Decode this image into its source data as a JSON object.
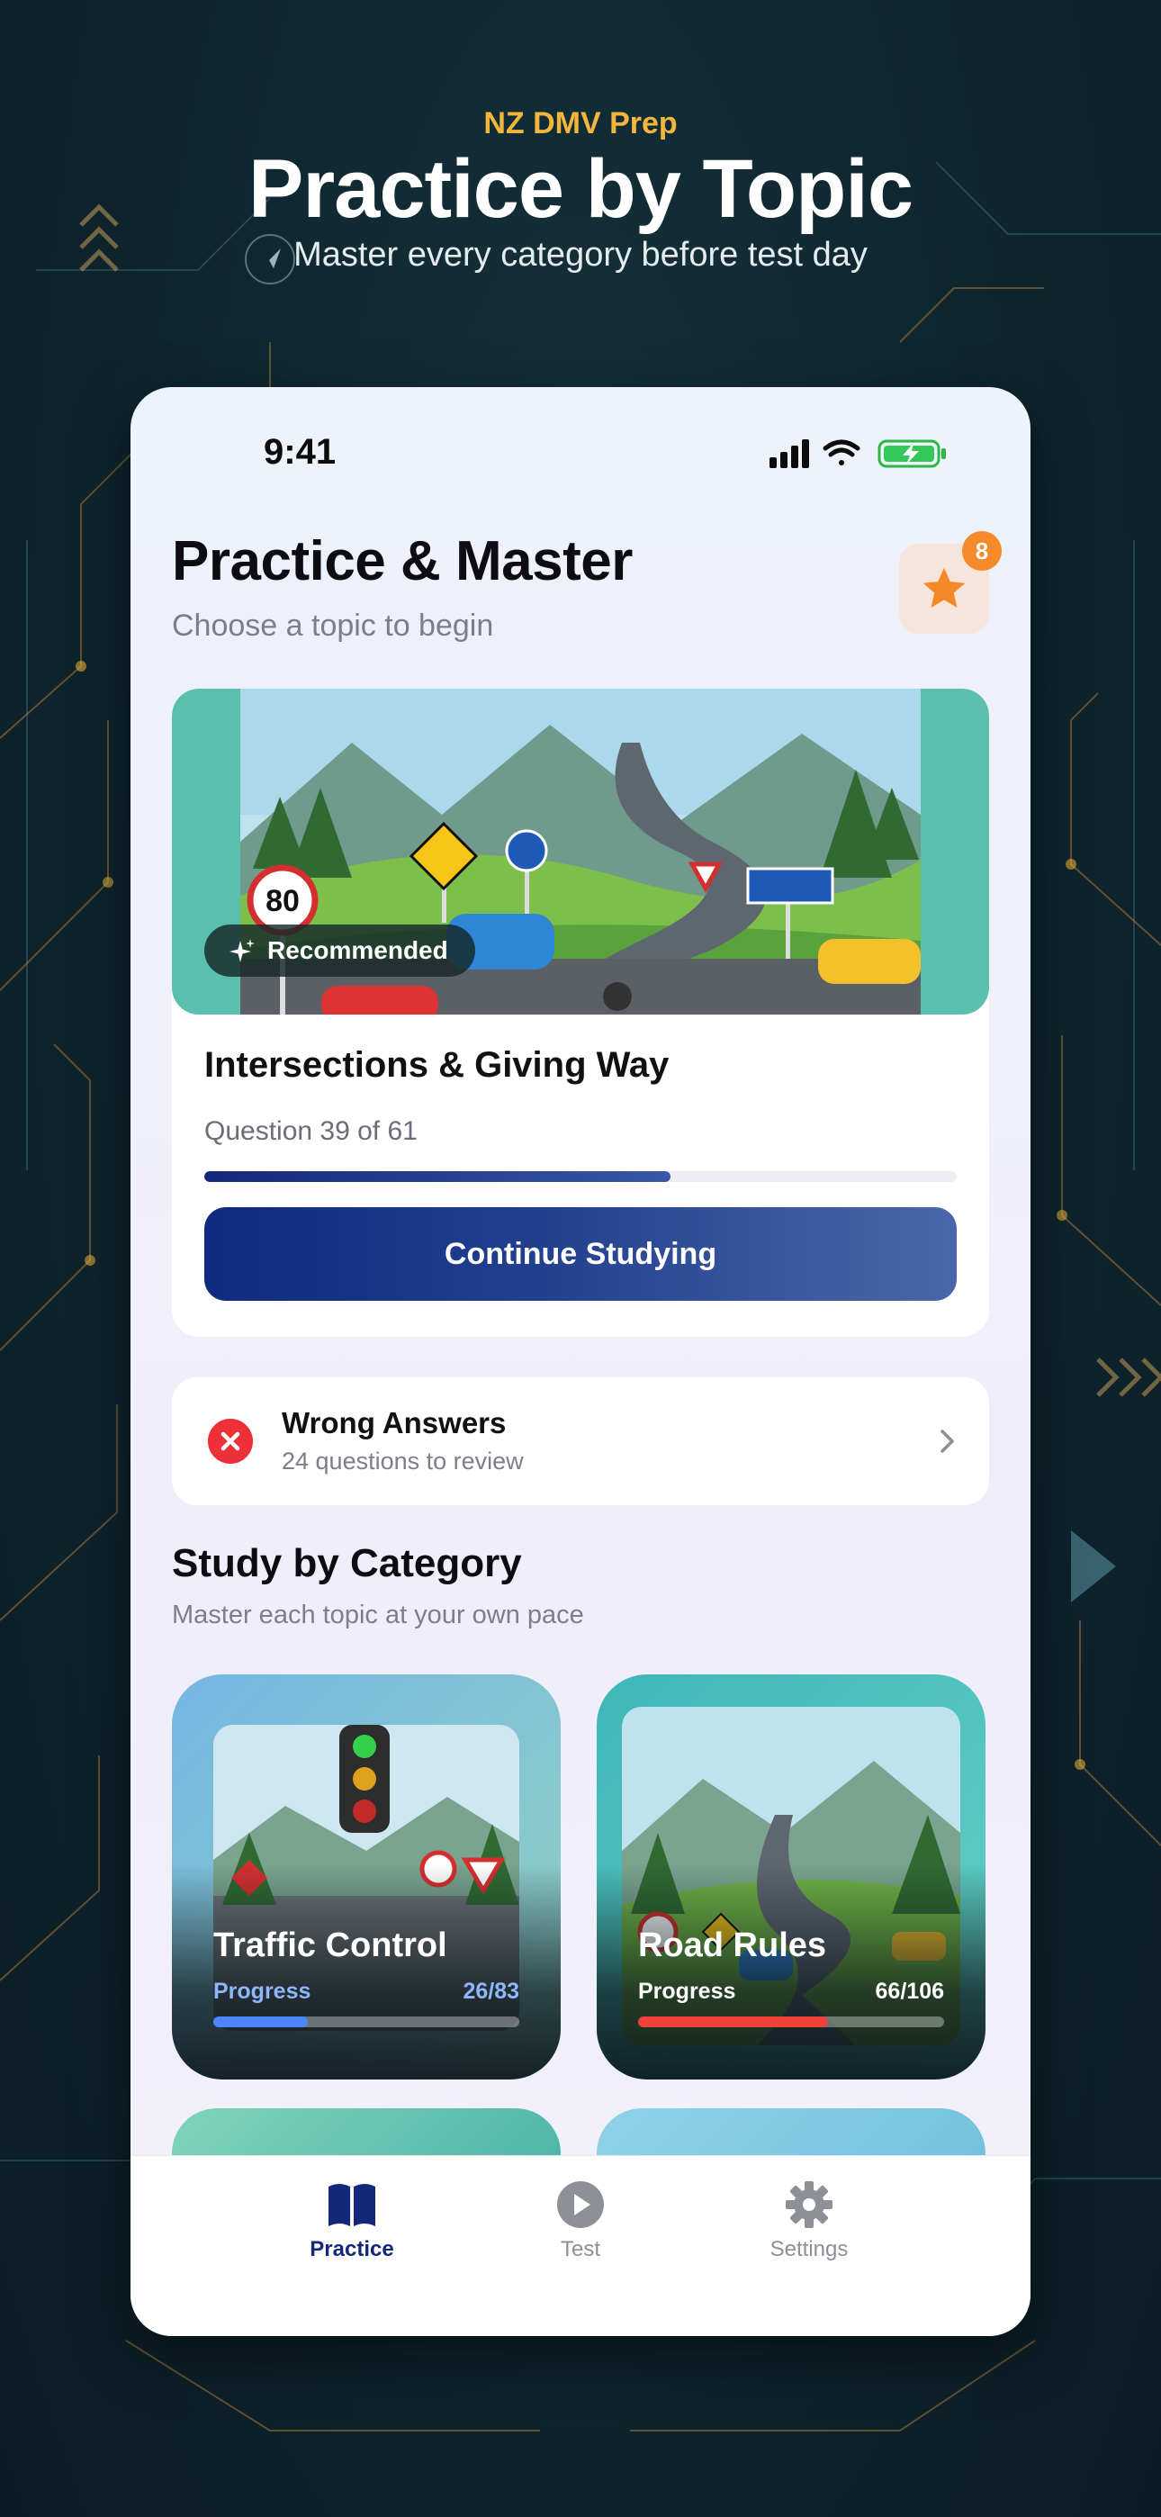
{
  "promo": {
    "eyebrow": "NZ DMV Prep",
    "title": "Practice by Topic",
    "subtitle": "Master every category before test day"
  },
  "status_bar": {
    "time": "9:41",
    "icons": [
      "signal-icon",
      "wifi-icon",
      "battery-charging-icon"
    ]
  },
  "header": {
    "title": "Practice & Master",
    "subtitle": "Choose a topic to begin",
    "favorites_badge": "8"
  },
  "featured": {
    "badge": "Recommended",
    "title": "Intersections & Giving Way",
    "progress_text": "Question 39 of 61",
    "progress_fraction": 0.62,
    "button": "Continue Studying"
  },
  "wrong_answers": {
    "title": "Wrong Answers",
    "subtitle": "24 questions to review"
  },
  "section": {
    "title": "Study by Category",
    "subtitle": "Master each topic at your own pace"
  },
  "categories": [
    {
      "title": "Traffic Control",
      "progress_label": "Progress",
      "count": "26/83",
      "fraction": 0.31,
      "color": "#4c86ff"
    },
    {
      "title": "Road Rules",
      "progress_label": "Progress",
      "count": "66/106",
      "fraction": 0.62,
      "color": "#f0403a"
    }
  ],
  "tabs": [
    {
      "label": "Practice",
      "icon": "book-icon",
      "active": true
    },
    {
      "label": "Test",
      "icon": "play-icon",
      "active": false
    },
    {
      "label": "Settings",
      "icon": "gear-icon",
      "active": false
    }
  ],
  "colors": {
    "accent": "#14287a",
    "eyebrow": "#f2b63d",
    "danger": "#ee3138",
    "badge": "#f58a2a"
  }
}
